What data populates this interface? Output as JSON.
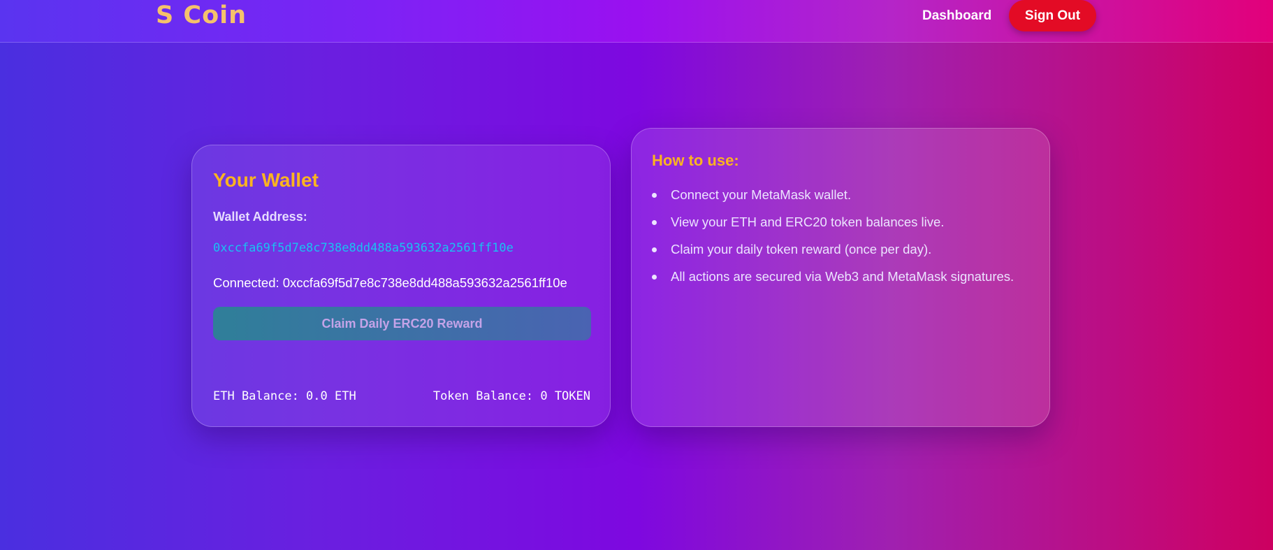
{
  "header": {
    "brand": "S Coin",
    "nav_dashboard": "Dashboard",
    "signout_label": "Sign Out"
  },
  "wallet": {
    "title": "Your Wallet",
    "address_label": "Wallet Address:",
    "address": "0xccfa69f5d7e8c738e8dd488a593632a2561ff10e",
    "connected": "Connected: 0xccfa69f5d7e8c738e8dd488a593632a2561ff10e",
    "claim_label": "Claim Daily ERC20 Reward",
    "eth_balance": "ETH Balance: 0.0 ETH",
    "token_balance": "Token Balance: 0 TOKEN"
  },
  "howto": {
    "title": "How to use:",
    "items": [
      "Connect your MetaMask wallet.",
      "View your ETH and ERC20 token balances live.",
      "Claim your daily token reward (once per day).",
      "All actions are secured via Web3 and MetaMask signatures."
    ]
  },
  "colors": {
    "accent": "#fbb420",
    "signout": "#e30b25",
    "address": "#19c3f2"
  }
}
